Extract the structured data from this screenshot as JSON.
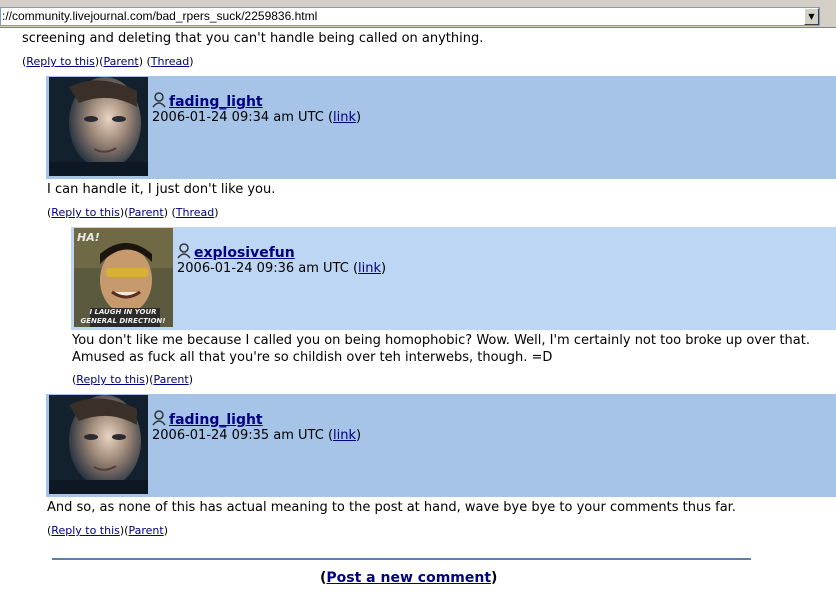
{
  "browser": {
    "url": "://community.livejournal.com/bad_rpers_suck/2259836.html"
  },
  "top_comment": {
    "text": "screening and deleting that you can't handle being called on anything.",
    "reply_label": "Reply to this",
    "parent_label": "Parent",
    "thread_label": "Thread"
  },
  "comments": [
    {
      "username": "fading_light",
      "date": "2006-01-24 09:34 am UTC",
      "link_label": "link",
      "text": "I can handle it, I just don't like you.",
      "reply_label": "Reply to this",
      "parent_label": "Parent",
      "thread_label": "Thread"
    },
    {
      "username": "explosivefun",
      "date": "2006-01-24 09:36 am UTC",
      "link_label": "link",
      "avatar_text_top": "HA!",
      "avatar_text_bottom_1": "I LAUGH IN YOUR",
      "avatar_text_bottom_2": "GENERAL DIRECTION!",
      "text_line1": "You don't like me because I called you on being homophobic? Wow. Well, I'm certainly not too broke up over that.",
      "text_line2": "Amused as fuck all that you're so childish over teh interwebs, though. =D",
      "reply_label": "Reply to this",
      "parent_label": "Parent"
    },
    {
      "username": "fading_light",
      "date": "2006-01-24 09:35 am UTC",
      "link_label": "link",
      "text": "And so, as none of this has actual meaning to the post at hand, wave bye bye to your comments thus far.",
      "reply_label": "Reply to this",
      "parent_label": "Parent"
    }
  ],
  "footer": {
    "post_new_label": "Post a new comment"
  }
}
